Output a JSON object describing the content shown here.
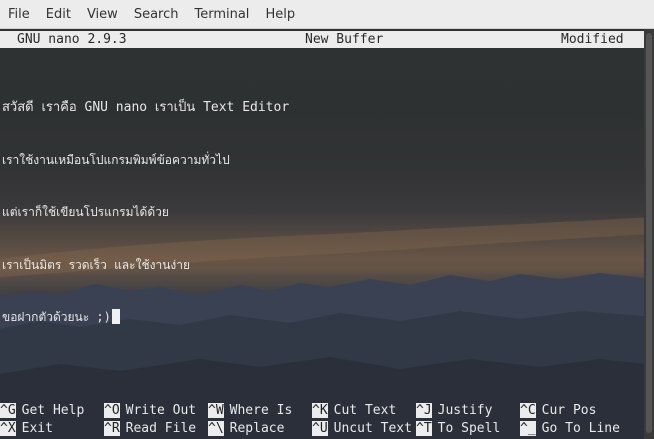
{
  "menubar": {
    "items": [
      "File",
      "Edit",
      "View",
      "Search",
      "Terminal",
      "Help"
    ]
  },
  "nano": {
    "version": "GNU nano 2.9.3",
    "buffer": "New Buffer",
    "status": "Modified"
  },
  "editor": {
    "lines": [
      "สวัสดี เราคือ GNU nano เราเป็น Text Editor",
      "เราใช้งานเหมือนโปแกรมพิมพ์ข้อความทั่วไป",
      "แต่เราก็ใช้เขียนโปรแกรมได้ด้วย",
      "เราเป็นมิตร รวดเร็ว และใช้งานง่าย",
      "ขอฝากตัวด้วยนะ ;)"
    ]
  },
  "shortcuts": [
    {
      "key": "^G",
      "label": "Get Help"
    },
    {
      "key": "^O",
      "label": "Write Out"
    },
    {
      "key": "^W",
      "label": "Where Is"
    },
    {
      "key": "^K",
      "label": "Cut Text"
    },
    {
      "key": "^J",
      "label": "Justify"
    },
    {
      "key": "^C",
      "label": "Cur Pos"
    },
    {
      "key": "^X",
      "label": "Exit"
    },
    {
      "key": "^R",
      "label": "Read File"
    },
    {
      "key": "^\\",
      "label": "Replace"
    },
    {
      "key": "^U",
      "label": "Uncut Text"
    },
    {
      "key": "^T",
      "label": "To Spell"
    },
    {
      "key": "^_",
      "label": "Go To Line"
    }
  ],
  "colors": {
    "menubar_bg": "#ececec",
    "titlebar_bg": "#ececec",
    "text": "#e8e8e8"
  }
}
